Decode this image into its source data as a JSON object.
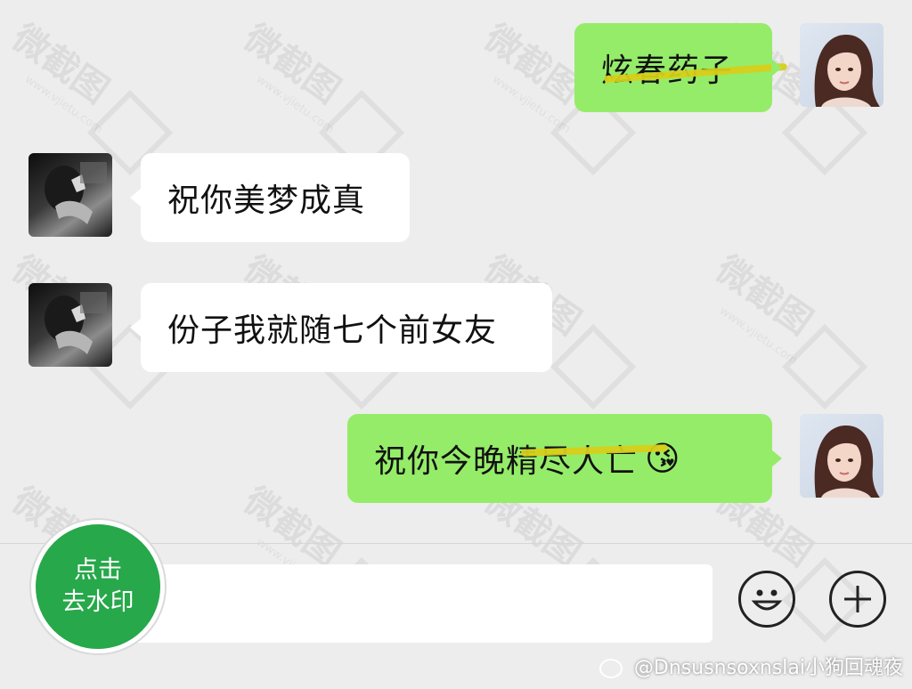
{
  "messages": [
    {
      "side": "right",
      "text": "炫春药子"
    },
    {
      "side": "left",
      "text": "祝你美梦成真"
    },
    {
      "side": "left",
      "text": "份子我就随七个前女友"
    },
    {
      "side": "right",
      "text": "祝你今晚精尽人亡",
      "emoji": "😘"
    }
  ],
  "input": {
    "placeholder": ""
  },
  "toolbar": {
    "emoji_icon": "☺",
    "plus_icon": "+"
  },
  "badge": {
    "line1": "点击",
    "line2": "去水印"
  },
  "watermark": {
    "text": "微截图",
    "url": "www.vjietu.com"
  },
  "credit": "@Dnsusnsoxnslai小狗回魂夜",
  "colors": {
    "my_bubble": "#95ec69",
    "other_bubble": "#ffffff",
    "badge": "#27a84a",
    "background": "#ededed"
  }
}
